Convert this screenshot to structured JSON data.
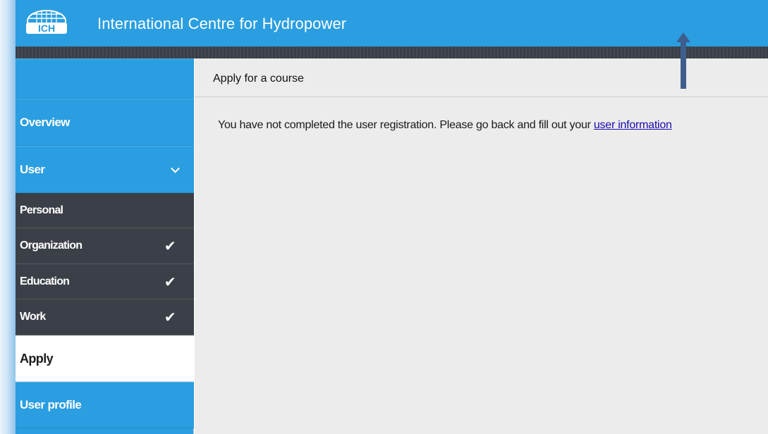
{
  "header": {
    "logo_text": "ICH",
    "title": "International Centre for Hydropower"
  },
  "sidebar": {
    "items": [
      {
        "label": "Overview",
        "icon": ""
      },
      {
        "label": "User",
        "icon": "chevron-down-icon"
      },
      {
        "label": "Personal",
        "icon": ""
      },
      {
        "label": "Organization",
        "icon": "checkmark-icon"
      },
      {
        "label": "Education",
        "icon": "checkmark-icon"
      },
      {
        "label": "Work",
        "icon": "checkmark-icon"
      },
      {
        "label": "Apply",
        "icon": ""
      },
      {
        "label": "User profile",
        "icon": ""
      }
    ],
    "active": "Apply"
  },
  "main": {
    "title": "Apply for a course",
    "message": "You have not completed the user registration. Please go back and fill out your ",
    "link": "user information"
  },
  "colors": {
    "brand": "#2a9ee0",
    "submenu": "#3b4048",
    "content_bg": "#ececec",
    "link": "#1a0dab",
    "annotation_arrow": "#3e5f8d"
  }
}
